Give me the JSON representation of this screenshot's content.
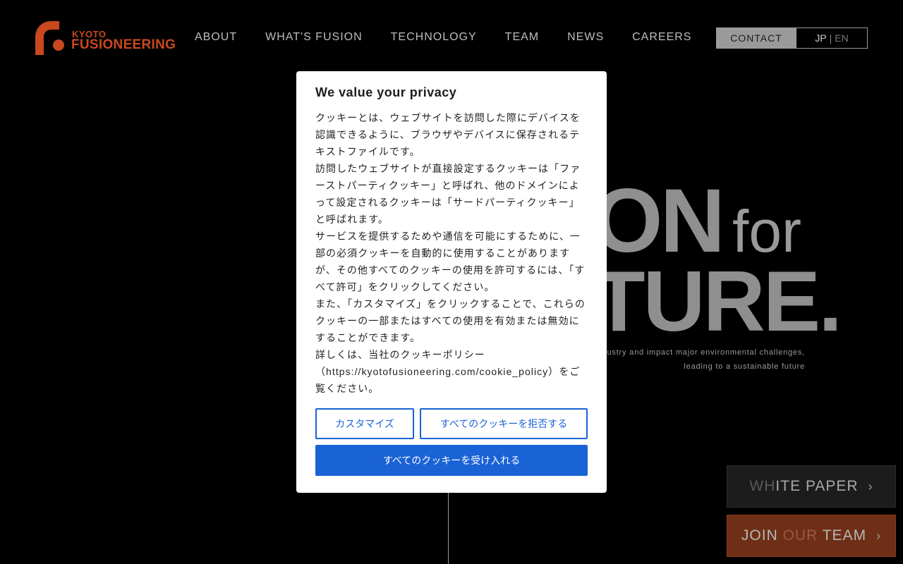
{
  "header": {
    "logo_top": "KYOTO",
    "logo_bottom": "FUSIONEERING",
    "nav": [
      "ABOUT",
      "WHAT'S FUSION",
      "TECHNOLOGY",
      "TEAM",
      "NEWS",
      "CAREERS"
    ],
    "contact_label": "CONTACT",
    "lang_jp": "JP",
    "lang_sep": "|",
    "lang_en": "EN"
  },
  "hero": {
    "line1_big": "ON",
    "line1_small": "for",
    "line2": "TURE.",
    "tagline1": "industry and impact major environmental challenges,",
    "tagline2": "leading to a sustainable future"
  },
  "side_buttons": {
    "white_paper_a": "WH",
    "white_paper_b": "ITE",
    "white_paper_c": "PAPER",
    "join_a": "JOIN",
    "join_b": "OUR",
    "join_c": "TEAM"
  },
  "cookie_dialog": {
    "title": "We value your privacy",
    "body": [
      "クッキーとは、ウェブサイトを訪問した際にデバイスを認識できるように、ブラウザやデバイスに保存されるテキストファイルです。",
      "訪問したウェブサイトが直接設定するクッキーは「ファーストパーティクッキー」と呼ばれ、他のドメインによって設定されるクッキーは「サードパーティクッキー」と呼ばれます。",
      "サービスを提供するためや通信を可能にするために、一部の必須クッキーを自動的に使用することがありますが、その他すべてのクッキーの使用を許可するには、「すべて許可」をクリックしてください。",
      "また、「カスタマイズ」をクリックすることで、これらのクッキーの一部またはすべての使用を有効または無効にすることができます。",
      "詳しくは、当社のクッキーポリシー（https://kyotofusioneering.com/cookie_policy）をご覧ください。"
    ],
    "customize_label": "カスタマイズ",
    "reject_label": "すべてのクッキーを拒否する",
    "accept_label": "すべてのクッキーを受け入れる"
  },
  "colors": {
    "brand": "#c9481e",
    "accent_button": "#1a63d6",
    "background": "#000000"
  },
  "icons": {
    "logo": "kyoto-fusioneering-logo-icon",
    "chevron": "chevron-right-icon"
  }
}
